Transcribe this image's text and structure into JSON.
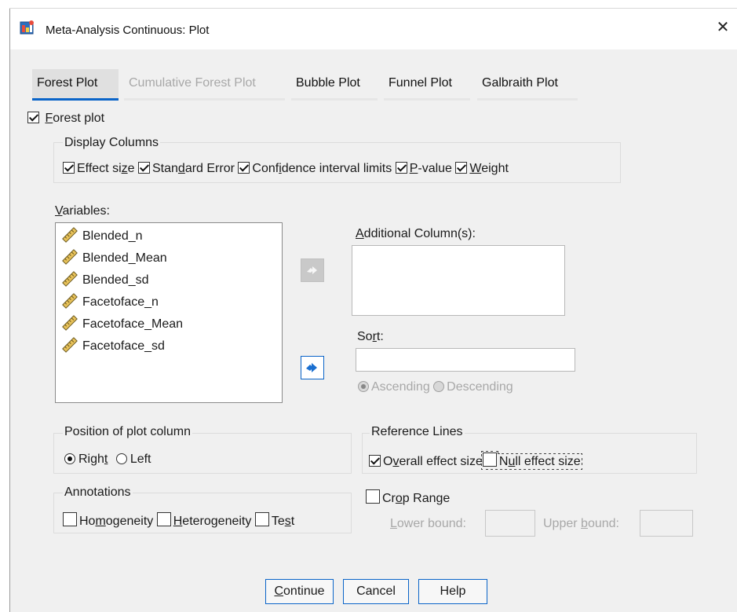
{
  "window": {
    "title": "Meta-Analysis Continuous: Plot",
    "close_glyph": "✕"
  },
  "tabs": [
    {
      "label": "Forest Plot",
      "active": true,
      "enabled": true
    },
    {
      "label": "Cumulative Forest Plot",
      "active": false,
      "enabled": false
    },
    {
      "label": "Bubble Plot",
      "active": false,
      "enabled": true
    },
    {
      "label": "Funnel Plot",
      "active": false,
      "enabled": true
    },
    {
      "label": "Galbraith Plot",
      "active": false,
      "enabled": true
    }
  ],
  "forest_plot_checkbox": {
    "label_hotkey": "F",
    "label_rest": "orest plot",
    "checked": true
  },
  "display_columns": {
    "title": "Display Columns",
    "items": [
      {
        "pre": "Effect si",
        "hotkey": "z",
        "post": "e",
        "checked": true
      },
      {
        "pre": "Stan",
        "hotkey": "d",
        "post": "ard Error",
        "checked": true
      },
      {
        "pre": "Conf",
        "hotkey": "i",
        "post": "dence interval limits",
        "checked": true
      },
      {
        "pre": "",
        "hotkey": "P",
        "post": "-value",
        "checked": true
      },
      {
        "pre": "",
        "hotkey": "W",
        "post": "eight",
        "checked": true
      }
    ]
  },
  "variables": {
    "label_hotkey": "V",
    "label_rest": "ariables:",
    "items": [
      "Blended_n",
      "Blended_Mean",
      "Blended_sd",
      "Facetoface_n",
      "Facetoface_Mean",
      "Facetoface_sd"
    ],
    "icon": "scale-ruler-icon"
  },
  "additional_columns": {
    "label_hotkey": "A",
    "label_rest": "dditional Column(s):"
  },
  "sort": {
    "label_pre": "So",
    "label_hotkey": "r",
    "label_post": "t:",
    "value": "",
    "ascending": {
      "label": "Ascending",
      "checked": true,
      "enabled": false
    },
    "descending": {
      "label": "Descending",
      "checked": false,
      "enabled": false
    }
  },
  "position": {
    "title": "Position of plot column",
    "right": {
      "pre": "Righ",
      "hotkey": "t",
      "post": "",
      "checked": true
    },
    "left": {
      "label": "Left",
      "checked": false
    }
  },
  "reference_lines": {
    "title": "Reference Lines",
    "overall": {
      "pre": "O",
      "hotkey": "v",
      "post": "erall effect size",
      "checked": true
    },
    "null": {
      "pre": "N",
      "hotkey": "u",
      "post": "ll effect size",
      "checked": false
    }
  },
  "annotations": {
    "title": "Annotations",
    "items": [
      {
        "pre": "Ho",
        "hotkey": "m",
        "post": "ogeneity",
        "checked": false
      },
      {
        "pre": "",
        "hotkey": "H",
        "post": "eterogeneity",
        "checked": false
      },
      {
        "pre": "Te",
        "hotkey": "s",
        "post": "t",
        "checked": false
      }
    ]
  },
  "crop_range": {
    "pre": "Cr",
    "hotkey": "o",
    "post": "p Range",
    "checked": false,
    "lower": {
      "hotkey": "L",
      "rest": "ower bound:",
      "value": ""
    },
    "upper": {
      "pre": "Upper ",
      "hotkey": "b",
      "post": "ound:",
      "value": ""
    }
  },
  "buttons": {
    "continue": {
      "hotkey": "C",
      "rest": "ontinue"
    },
    "cancel": "Cancel",
    "help": "Help"
  },
  "colors": {
    "accent": "#0a64c8",
    "dialog_bg": "#f0f0f0",
    "disabled_text": "#a8a8a8"
  }
}
